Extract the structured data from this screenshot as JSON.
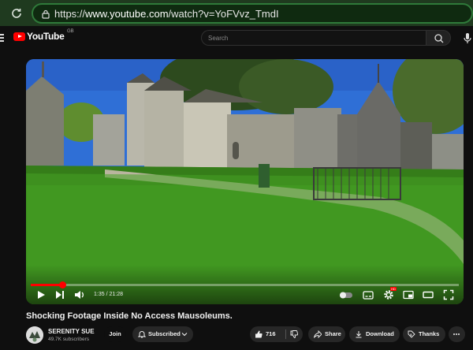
{
  "browser": {
    "reload_icon": "reload-icon",
    "url_prefix": "https://",
    "url_host": "www.youtube.com",
    "url_path": "/watch?v=YoFVvz_TmdI"
  },
  "youtube": {
    "logo_text": "YouTube",
    "country_code": "GB",
    "search_placeholder": "Search"
  },
  "player": {
    "current_time": "1:35",
    "duration": "21:28",
    "time_display": "1:35 / 21:28",
    "progress_fraction": 0.074,
    "accent_color": "#ff0000",
    "hd_badge": "HD"
  },
  "video": {
    "title": "Shocking Footage Inside No Access Mausoleums."
  },
  "channel": {
    "name": "SERENITY SUE",
    "subscribers": "49.7K subscribers",
    "join_label": "Join",
    "subscribed_label": "Subscribed"
  },
  "actions": {
    "like_count": "716",
    "share_label": "Share",
    "download_label": "Download",
    "thanks_label": "Thanks"
  }
}
